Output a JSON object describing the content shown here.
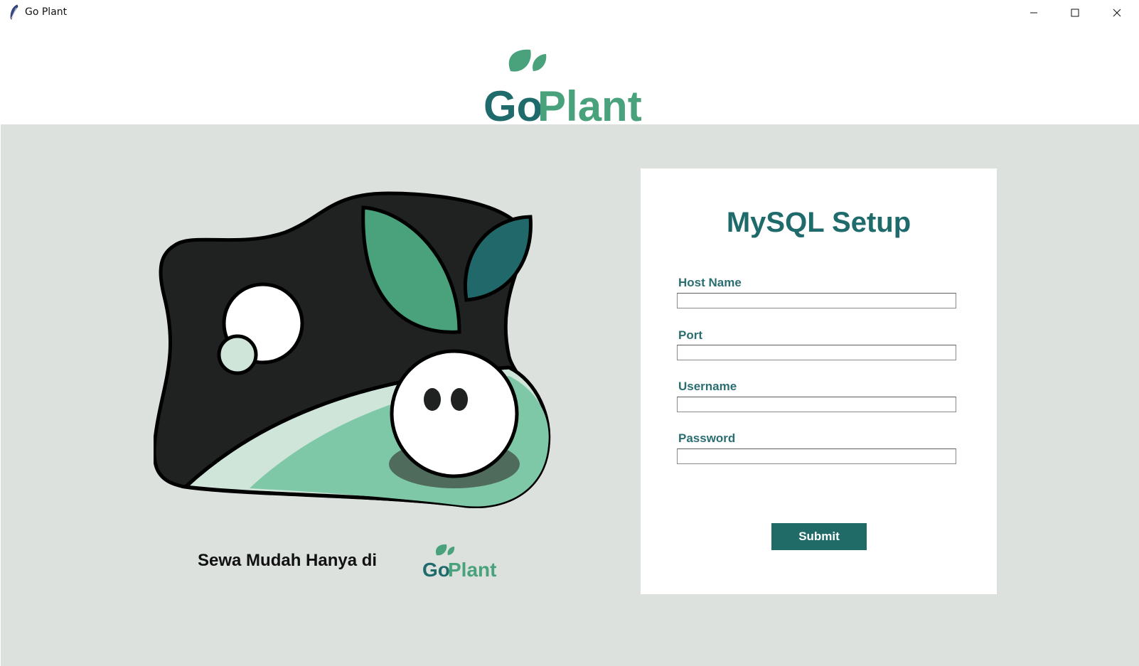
{
  "window": {
    "title": "Go Plant",
    "icon": "feather-icon",
    "controls": {
      "minimize": "minimize-icon",
      "maximize": "maximize-icon",
      "close": "close-icon"
    }
  },
  "brand": {
    "logo_text_go": "Go",
    "logo_text_plant": "Plant",
    "colors": {
      "go": "#1f6b6b",
      "plant": "#4aa27c",
      "leaf": "#4aa27c"
    }
  },
  "main": {
    "background": "#dce1de",
    "tagline": "Sewa Mudah Hanya di"
  },
  "form": {
    "title": "MySQL Setup",
    "fields": [
      {
        "label": "Host Name",
        "value": ""
      },
      {
        "label": "Port",
        "value": ""
      },
      {
        "label": "Username",
        "value": ""
      },
      {
        "label": "Password",
        "value": ""
      }
    ],
    "submit_label": "Submit",
    "accent": "#206a68"
  }
}
